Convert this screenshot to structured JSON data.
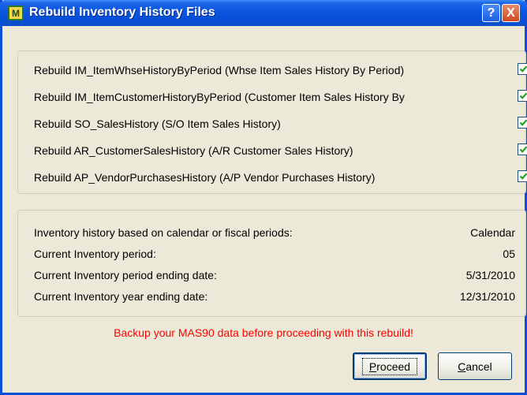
{
  "window": {
    "title": "Rebuild Inventory History Files",
    "help_glyph": "?",
    "close_glyph": "X",
    "app_icon_text": "M"
  },
  "rebuild_options": [
    {
      "label": "Rebuild IM_ItemWhseHistoryByPeriod (Whse Item Sales History By Period)",
      "checked": true
    },
    {
      "label": "Rebuild IM_ItemCustomerHistoryByPeriod  (Customer Item Sales History By",
      "checked": true
    },
    {
      "label": "Rebuild SO_SalesHistory (S/O Item Sales History)",
      "checked": true
    },
    {
      "label": "Rebuild AR_CustomerSalesHistory (A/R Customer Sales History)",
      "checked": true
    },
    {
      "label": "Rebuild AP_VendorPurchasesHistory (A/P Vendor Purchases History)",
      "checked": true
    }
  ],
  "info": [
    {
      "label": "Inventory history based on calendar or fiscal periods:",
      "value": "Calendar"
    },
    {
      "label": "Current Inventory period:",
      "value": "05"
    },
    {
      "label": "Current Inventory period ending date:",
      "value": "5/31/2010"
    },
    {
      "label": "Current Inventory year ending date:",
      "value": "12/31/2010"
    }
  ],
  "warning": "Backup your MAS90 data before proceeding with this rebuild!",
  "buttons": {
    "proceed_first": "P",
    "proceed_rest": "roceed",
    "cancel_first": "C",
    "cancel_rest": "ancel"
  },
  "colors": {
    "titlebar": "#0a55e0",
    "warning": "#ff0000",
    "checkmark": "#21a121"
  }
}
